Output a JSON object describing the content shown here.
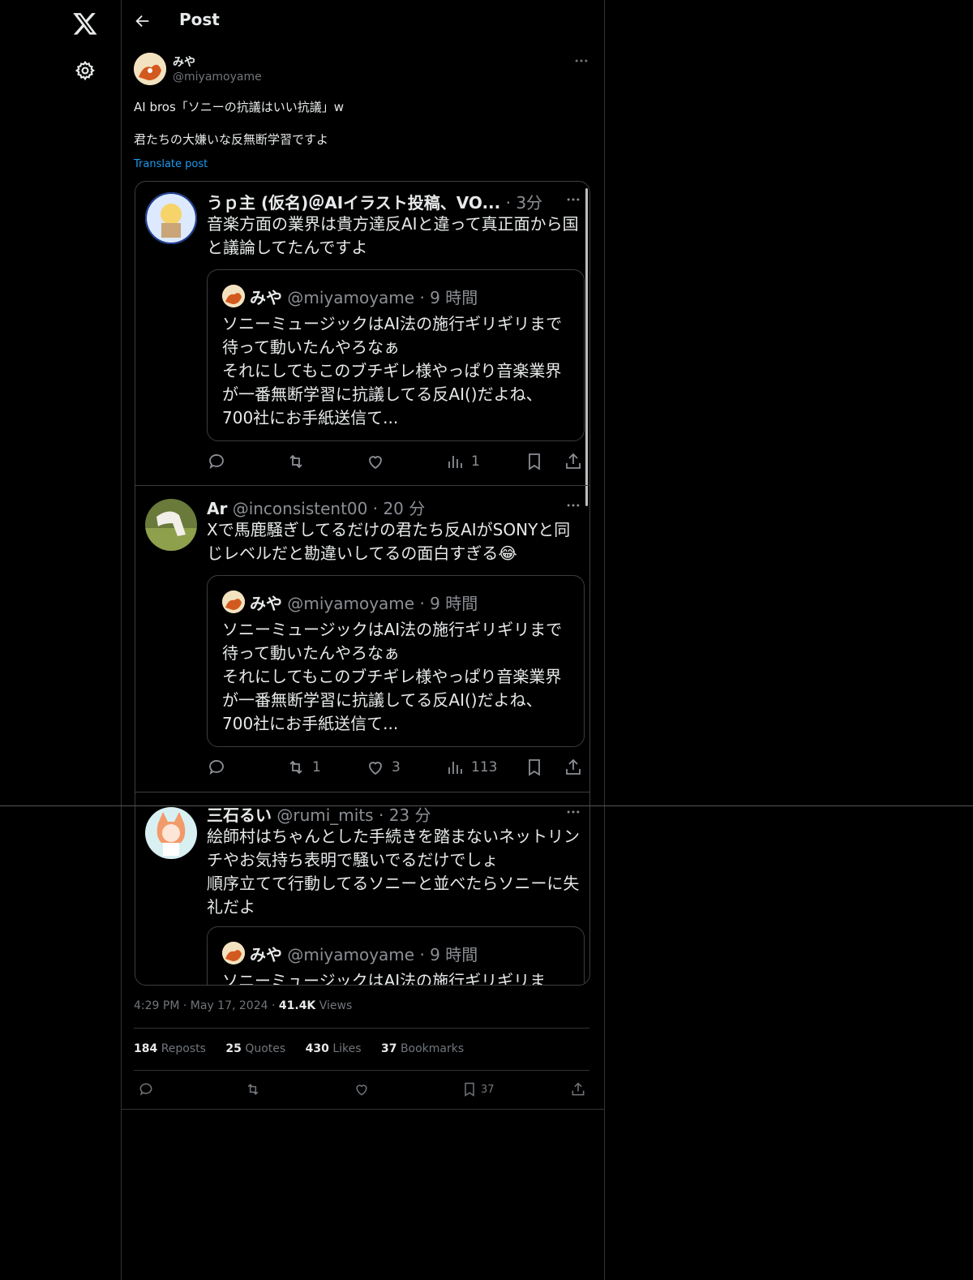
{
  "nav": {
    "title": "Post"
  },
  "post": {
    "author_name": "みや",
    "author_handle": "@miyamoyame",
    "text": "AI bros「ソニーの抗議はいい抗議」w\n\n君たちの大嫌いな反無断学習ですよ",
    "translate_label": "Translate post",
    "time": "4:29 PM",
    "date": "May 17, 2024",
    "views_count": "41.4K",
    "views_label": "Views",
    "stats": [
      {
        "count": "184",
        "label": "Reposts"
      },
      {
        "count": "25",
        "label": "Quotes"
      },
      {
        "count": "430",
        "label": "Likes"
      },
      {
        "count": "37",
        "label": "Bookmarks"
      }
    ],
    "bookmark_count": "37"
  },
  "embedded": {
    "replies": [
      {
        "name": "うｐ主 (仮名)＠AIイラスト投稿、VO...",
        "handle": "",
        "time": "3分",
        "text": "音楽方面の業界は貴方達反AIと違って真正面から国と議論してたんですよ",
        "quote_name": "みや",
        "quote_handle": "@miyamoyame",
        "quote_time": "9 時間",
        "quote_text": "ソニーミュージックはAI法の施行ギリギリまで待って動いたんやろなぁ\nそれにしてもこのブチギレ様やっぱり音楽業界が一番無断学習に抗議してる反AI()だよね、700社にお手紙送信て...",
        "reposts": "",
        "likes": "",
        "views": "1"
      },
      {
        "name": "Ar",
        "handle": "@inconsistent00",
        "time": "20 分",
        "text": "Xで馬鹿騒ぎしてるだけの君たち反AIがSONYと同じレベルだと勘違いしてるの面白すぎる😂",
        "quote_name": "みや",
        "quote_handle": "@miyamoyame",
        "quote_time": "9 時間",
        "quote_text": "ソニーミュージックはAI法の施行ギリギリまで待って動いたんやろなぁ\nそれにしてもこのブチギレ様やっぱり音楽業界が一番無断学習に抗議してる反AI()だよね、700社にお手紙送信て...",
        "reposts": "1",
        "likes": "3",
        "views": "113"
      },
      {
        "name": "三石るい",
        "handle": "@rumi_mits",
        "time": "23 分",
        "text": "絵師村はちゃんとした手続きを踏まないネットリンチやお気持ち表明で騒いでるだけでしょ\n順序立てて行動してるソニーと並べたらソニーに失礼だよ",
        "quote_name": "みや",
        "quote_handle": "@miyamoyame",
        "quote_time": "9 時間",
        "quote_text": "ソニーミュージックはAI法の施行ギリギリま"
      }
    ]
  },
  "colors": {
    "accent": "#1d9bf0",
    "muted": "#71767b",
    "text": "#e7e9ea",
    "bg": "#000000"
  }
}
